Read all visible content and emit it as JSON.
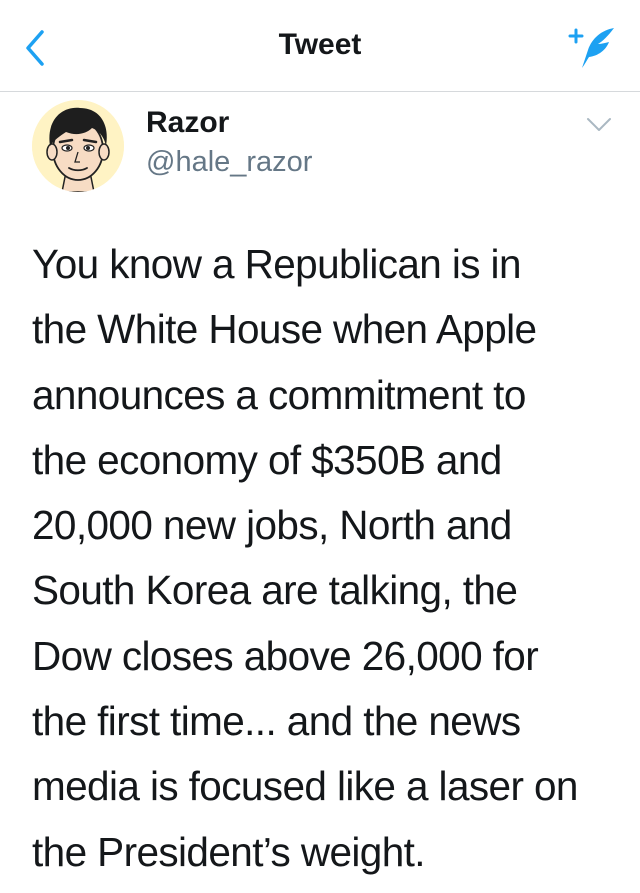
{
  "nav": {
    "title": "Tweet",
    "accent_color": "#1da1f2",
    "back_icon": "chevron-left-icon",
    "compose_icon": "compose-feather-icon"
  },
  "tweet": {
    "author": {
      "name": "Razor",
      "handle": "@hale_razor",
      "avatar_icon": "cartoon-avatar"
    },
    "more_icon": "chevron-down-icon",
    "lines": [
      "You know a Republican is in",
      "the White House when Apple",
      "announces a commitment to",
      "the economy of $350B and",
      "20,000 new jobs, North and",
      "South Korea are talking, the",
      "Dow closes above 26,000 for",
      "the first time... and the news",
      "media is focused like a laser on",
      "the President’s weight."
    ]
  }
}
